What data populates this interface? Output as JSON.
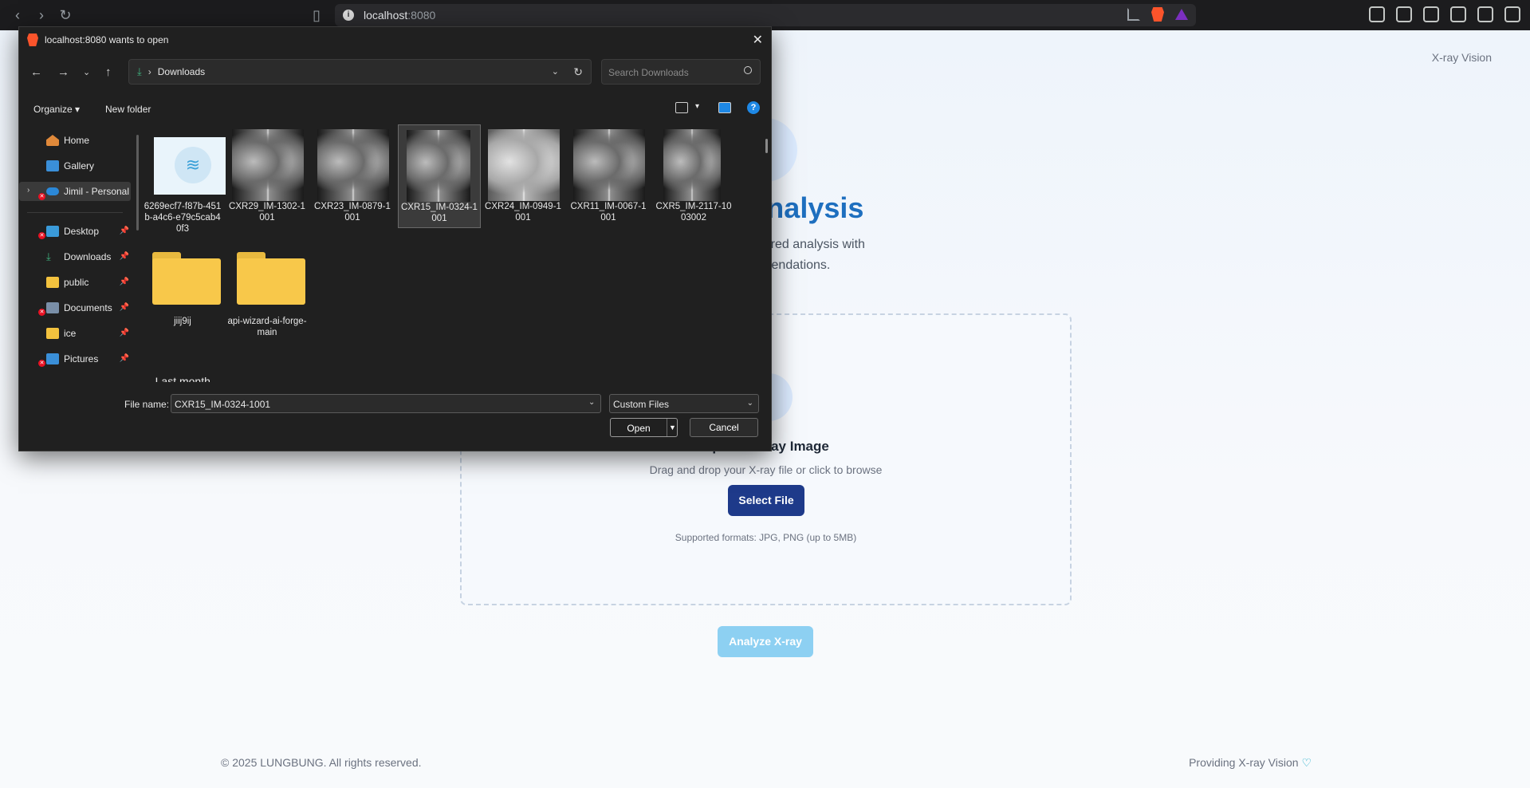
{
  "browser": {
    "url_host": "localhost",
    "url_port": ":8080"
  },
  "page": {
    "brand": "X-ray Vision",
    "hero_title": "X-ray Analysis",
    "hero_subtitle_line1": "an instant AI-powered analysis with",
    "hero_subtitle_line2": "and recommendations.",
    "upload_title": "Upload X-ray Image",
    "upload_hint": "Drag and drop your X-ray file or click to browse",
    "select_file": "Select File",
    "formats": "Supported formats: JPG, PNG (up to 5MB)",
    "analyze": "Analyze X-ray",
    "footer_left": "© 2025 LUNGBUNG. All rights reserved.",
    "footer_right": "Providing X-ray Vision"
  },
  "dialog": {
    "title": "localhost:8080 wants to open",
    "address": "Downloads",
    "search_placeholder": "Search Downloads",
    "organize": "Organize",
    "new_folder": "New folder",
    "nav": [
      {
        "label": "Home",
        "icon": "home-icon"
      },
      {
        "label": "Gallery",
        "icon": "gallery-icon"
      },
      {
        "label": "Jimil - Personal",
        "icon": "onedrive-icon"
      },
      {
        "label": "Desktop",
        "icon": "desktop-icon"
      },
      {
        "label": "Downloads",
        "icon": "downloads-icon"
      },
      {
        "label": "public",
        "icon": "folder-icon"
      },
      {
        "label": "Documents",
        "icon": "documents-icon"
      },
      {
        "label": "ice",
        "icon": "folder-icon"
      },
      {
        "label": "Pictures",
        "icon": "pictures-icon"
      }
    ],
    "files": [
      {
        "name": "6269ecf7-f87b-451b-a4c6-e79c5cab40f3",
        "kind": "image"
      },
      {
        "name": "CXR29_IM-1302-1001",
        "kind": "xray"
      },
      {
        "name": "CXR23_IM-0879-1001",
        "kind": "xray"
      },
      {
        "name": "CXR15_IM-0324-1001",
        "kind": "xray",
        "selected": true
      },
      {
        "name": "CXR24_IM-0949-1001",
        "kind": "xray"
      },
      {
        "name": "CXR11_IM-0067-1001",
        "kind": "xray"
      },
      {
        "name": "CXR5_IM-2117-1003002",
        "kind": "xray"
      },
      {
        "name": "jiij9ij",
        "kind": "folder"
      },
      {
        "name": "api-wizard-ai-forge-main",
        "kind": "folder"
      }
    ],
    "group_last_month": "Last month",
    "file_name_label": "File name:",
    "file_name_value": "CXR15_IM-0324-1001",
    "file_type": "Custom Files",
    "open": "Open",
    "cancel": "Cancel"
  }
}
